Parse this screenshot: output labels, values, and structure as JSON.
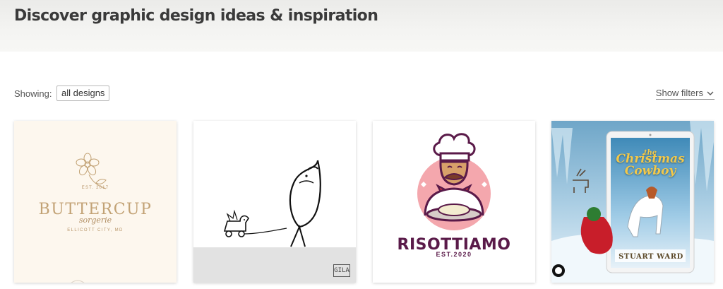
{
  "header": {
    "title": "Discover graphic design ideas & inspiration"
  },
  "filters": {
    "showing_label": "Showing:",
    "showing_value": "all designs",
    "show_filters_label": "Show filters"
  },
  "designs": [
    {
      "brand": "BUTTERCUP",
      "script": "sorgerie",
      "est": "EST. 2017",
      "city": "ELLICOTT CITY, MD",
      "accent": "#c2a275",
      "background": "#fdf7ee"
    },
    {
      "watermark": "GILA",
      "background": "#ffffff",
      "ground": "#e2e2e2"
    },
    {
      "brand": "RISOTTIAMO",
      "est": "EST.2020",
      "accent": "#5a1a49",
      "circle": "#f4a7ad"
    },
    {
      "series": "the",
      "title_line1": "Christmas",
      "title_line2": "Cowboy",
      "author": "STUART WARD",
      "accent": "#f2c84b"
    }
  ],
  "icons": {
    "show_filters": "chevron-down-icon",
    "flower": "flower-icon",
    "duck": "duck-toy-icon",
    "chef": "chef-mascot-icon",
    "tablet": "tablet-icon"
  }
}
